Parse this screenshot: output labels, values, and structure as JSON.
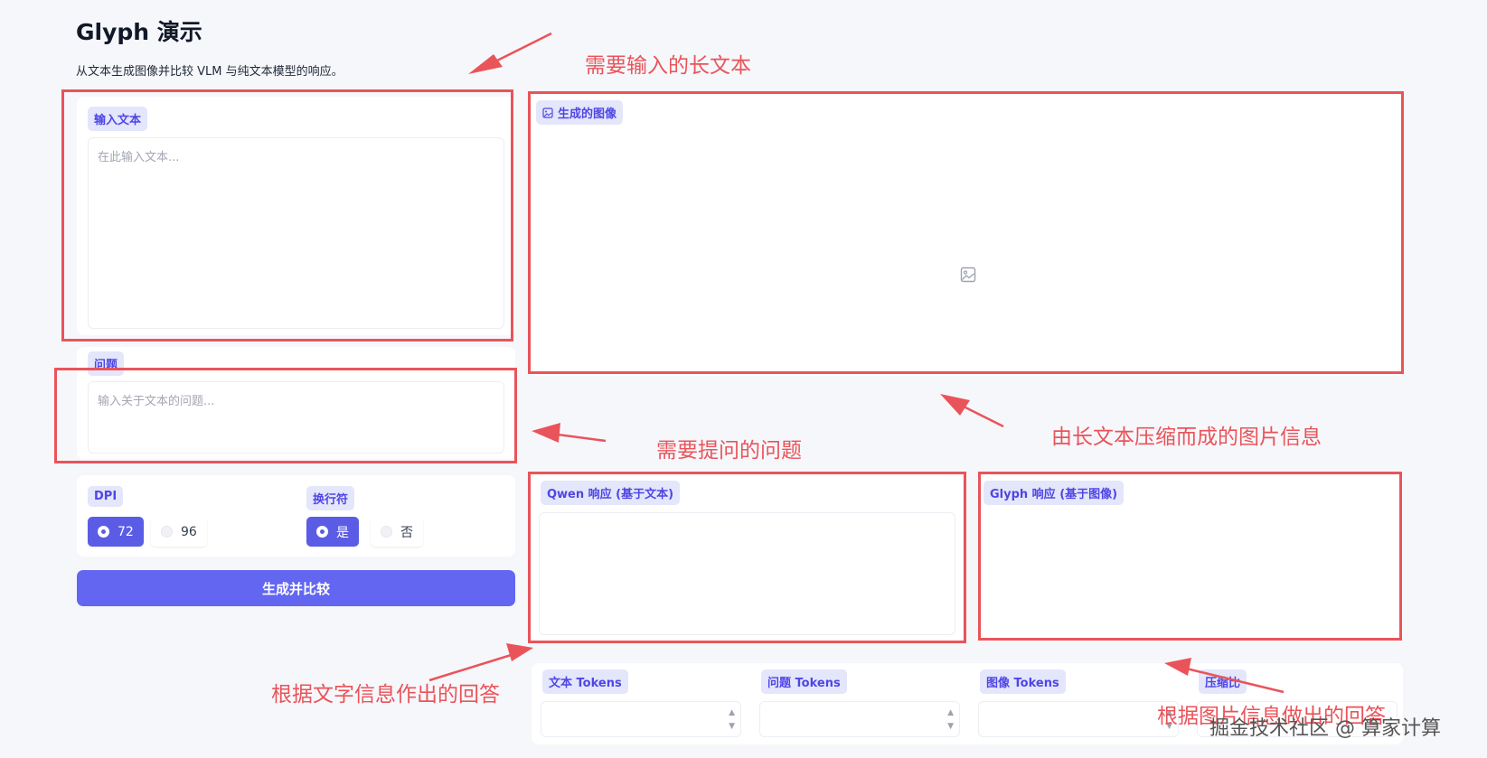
{
  "app": {
    "title": "Glyph 演示",
    "subtitle": "从文本生成图像并比较 VLM 与纯文本模型的响应。"
  },
  "input": {
    "label": "输入文本",
    "placeholder": "在此输入文本..."
  },
  "question": {
    "label": "问题",
    "placeholder": "输入关于文本的问题..."
  },
  "dpi": {
    "label": "DPI",
    "options": [
      "72",
      "96"
    ],
    "selected": "72"
  },
  "newline": {
    "label": "换行符",
    "options": [
      "是",
      "否"
    ],
    "selected": "是"
  },
  "actions": {
    "generate_label": "生成并比较"
  },
  "image_panel": {
    "label": "生成的图像",
    "icon": "image-icon"
  },
  "responses": {
    "qwen_label": "Qwen 响应 (基于文本)",
    "glyph_label": "Glyph 响应 (基于图像)"
  },
  "stats": {
    "text_tokens_label": "文本 Tokens",
    "question_tokens_label": "问题 Tokens",
    "image_tokens_label": "图像 Tokens",
    "ratio_label": "压缩比"
  },
  "annotations": {
    "long_text": "需要输入的长文本",
    "question": "需要提问的问题",
    "image_info": "由长文本压缩而成的图片信息",
    "text_answer": "根据文字信息作出的回答",
    "image_answer": "根据图片信息做出的回答"
  },
  "watermark": "掘金技术社区 @ 算家计算",
  "colors": {
    "accent": "#6366f1",
    "chip_bg": "#e4e6fb",
    "annotation_red": "#e9545a",
    "page_bg": "#f6f7fb"
  }
}
